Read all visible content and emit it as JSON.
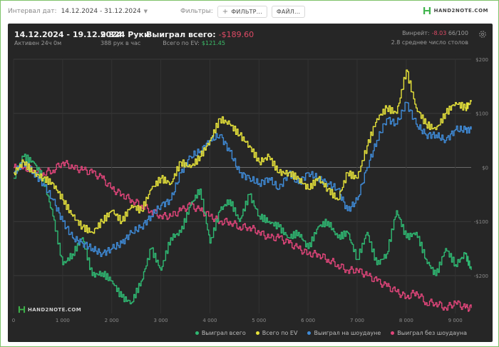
{
  "toolbar": {
    "interval_label": "Интервал дат:",
    "interval_value": "14.12.2024 - 31.12.2024",
    "filters_label": "Фильтры:",
    "filter_button": "ФИЛЬТР...",
    "file_button": "ФАЙЛ...",
    "brand": "HAND2NOTE.COM"
  },
  "header": {
    "range": "14.12.2024 - 19.12.2024",
    "active": "Активен 24ч 0м",
    "hands": "9 324 Руки",
    "hands_rate": "388 рук в час",
    "won_label": "Выиграл всего:",
    "won_value": "-$189.60",
    "ev_label": "Всего по EV:",
    "ev_value": "$121.45",
    "winrate_label": "Винрейт:",
    "winrate_value": "-8.03",
    "winrate_rest": "66/100",
    "tables": "2.8 среднее число столов"
  },
  "watermark": "HAND2NOTE.COM",
  "colors": {
    "total": "#2fb872",
    "ev": "#e6e23a",
    "showdown": "#3f8ad6",
    "nonshowdown": "#e0457a",
    "panel_bg": "#262626"
  },
  "chart_data": {
    "type": "line",
    "x_ticks": [
      "0",
      "1 000",
      "2 000",
      "3 000",
      "4 000",
      "5 000",
      "6 000",
      "7 000",
      "8 000",
      "9 000"
    ],
    "y_ticks": [
      "$200",
      "$100",
      "$0",
      "-$100",
      "-$200"
    ],
    "xlim": [
      0,
      9324
    ],
    "ylim": [
      -270,
      200
    ],
    "series": [
      {
        "name": "Выиграл всего",
        "color": "#2fb872",
        "x": [
          0,
          200,
          400,
          600,
          800,
          1000,
          1200,
          1400,
          1600,
          1800,
          2000,
          2200,
          2400,
          2600,
          2800,
          3000,
          3200,
          3400,
          3600,
          3800,
          4000,
          4200,
          4400,
          4600,
          4800,
          5000,
          5200,
          5400,
          5600,
          5800,
          6000,
          6200,
          6400,
          6600,
          6800,
          7000,
          7200,
          7400,
          7600,
          7800,
          8000,
          8200,
          8400,
          8600,
          8800,
          9000,
          9200,
          9324
        ],
        "y": [
          -20,
          20,
          10,
          -20,
          -90,
          -180,
          -160,
          -130,
          -200,
          -195,
          -210,
          -240,
          -250,
          -210,
          -150,
          -190,
          -130,
          -120,
          -70,
          -40,
          -140,
          -80,
          -60,
          -100,
          -50,
          -90,
          -100,
          -110,
          -130,
          -120,
          -150,
          -110,
          -100,
          -130,
          -120,
          -170,
          -120,
          -180,
          -160,
          -80,
          -130,
          -120,
          -170,
          -200,
          -150,
          -180,
          -160,
          -189.6
        ]
      },
      {
        "name": "Всего по EV",
        "color": "#e6e23a",
        "x": [
          0,
          200,
          400,
          600,
          800,
          1000,
          1200,
          1400,
          1600,
          1800,
          2000,
          2200,
          2400,
          2600,
          2800,
          3000,
          3200,
          3400,
          3600,
          3800,
          4000,
          4200,
          4400,
          4600,
          4800,
          5000,
          5200,
          5400,
          5600,
          5800,
          6000,
          6200,
          6400,
          6600,
          6800,
          7000,
          7200,
          7400,
          7600,
          7800,
          8000,
          8200,
          8400,
          8600,
          8800,
          9000,
          9200,
          9324
        ],
        "y": [
          -10,
          10,
          -10,
          -20,
          -30,
          -60,
          -90,
          -110,
          -120,
          -100,
          -80,
          -100,
          -70,
          -80,
          -40,
          -20,
          -30,
          10,
          0,
          20,
          50,
          90,
          80,
          60,
          40,
          10,
          20,
          -10,
          -10,
          -20,
          -40,
          -20,
          -40,
          -60,
          -10,
          -20,
          40,
          90,
          110,
          100,
          180,
          110,
          80,
          70,
          100,
          120,
          110,
          121.45
        ]
      },
      {
        "name": "Выиграл на шоудауне",
        "color": "#3f8ad6",
        "x": [
          0,
          200,
          400,
          600,
          800,
          1000,
          1200,
          1400,
          1600,
          1800,
          2000,
          2200,
          2400,
          2600,
          2800,
          3000,
          3200,
          3400,
          3600,
          3800,
          4000,
          4200,
          4400,
          4600,
          4800,
          5000,
          5200,
          5400,
          5600,
          5800,
          6000,
          6200,
          6400,
          6600,
          6800,
          7000,
          7200,
          7400,
          7600,
          7800,
          8000,
          8200,
          8400,
          8600,
          8800,
          9000,
          9200,
          9324
        ],
        "y": [
          -10,
          10,
          -10,
          -30,
          -60,
          -100,
          -130,
          -140,
          -150,
          -160,
          -150,
          -140,
          -120,
          -110,
          -90,
          -70,
          -60,
          -10,
          20,
          30,
          50,
          60,
          30,
          -10,
          -20,
          -30,
          -20,
          -40,
          -10,
          -30,
          -10,
          -20,
          -30,
          -40,
          -80,
          -60,
          0,
          50,
          90,
          80,
          120,
          80,
          60,
          60,
          50,
          70,
          70,
          70
        ]
      },
      {
        "name": "Выиграл без шоудауна",
        "color": "#e0457a",
        "x": [
          0,
          200,
          400,
          600,
          800,
          1000,
          1200,
          1400,
          1600,
          1800,
          2000,
          2200,
          2400,
          2600,
          2800,
          3000,
          3200,
          3400,
          3600,
          3800,
          4000,
          4200,
          4400,
          4600,
          4800,
          5000,
          5200,
          5400,
          5600,
          5800,
          6000,
          6200,
          6400,
          6600,
          6800,
          7000,
          7200,
          7400,
          7600,
          7800,
          8000,
          8200,
          8400,
          8600,
          8800,
          9000,
          9200,
          9324
        ],
        "y": [
          0,
          0,
          -5,
          -10,
          -5,
          10,
          0,
          -5,
          -10,
          -20,
          -40,
          -50,
          -60,
          -70,
          -80,
          -90,
          -90,
          -80,
          -70,
          -80,
          -90,
          -100,
          -100,
          -110,
          -110,
          -120,
          -130,
          -130,
          -140,
          -150,
          -160,
          -160,
          -170,
          -180,
          -190,
          -190,
          -200,
          -210,
          -220,
          -230,
          -240,
          -230,
          -250,
          -250,
          -260,
          -250,
          -260,
          -260
        ]
      }
    ]
  }
}
